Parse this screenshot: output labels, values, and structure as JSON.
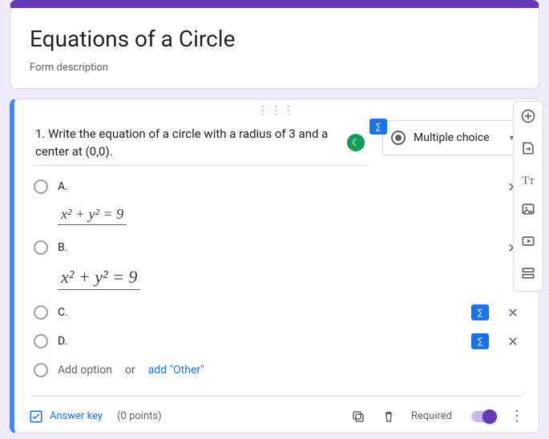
{
  "header": {
    "title": "Equations of a Circle",
    "description": "Form description"
  },
  "question": {
    "prompt": "1. Write the equation of a circle with a radius of 3 and a center at (0,0).",
    "type_label": "Multiple choice",
    "options": [
      {
        "label": "A.",
        "has_badge": false,
        "equation": "x² + y² = 9",
        "eq_big": false
      },
      {
        "label": "B.",
        "has_badge": false,
        "equation": "x² + y²  = 9",
        "eq_big": true
      },
      {
        "label": "C.",
        "has_badge": true
      },
      {
        "label": "D.",
        "has_badge": true
      }
    ],
    "add_option": "Add option",
    "or": "or",
    "add_other": "add \"Other\""
  },
  "footer": {
    "answer_key": "Answer key",
    "points": "(0 points)",
    "required": "Required"
  },
  "icons": {
    "equation_badge": "∑",
    "moon": "☾",
    "close": "✕",
    "copy": "⧉",
    "trash": "🗑",
    "check": "✓",
    "more": "⋮",
    "triangle": "▾",
    "plus": "⊕",
    "import": "⇥",
    "text": "Tᴛ",
    "image": "▣",
    "video": "▶",
    "section": "▤",
    "drag": "⋮⋮⋮"
  }
}
